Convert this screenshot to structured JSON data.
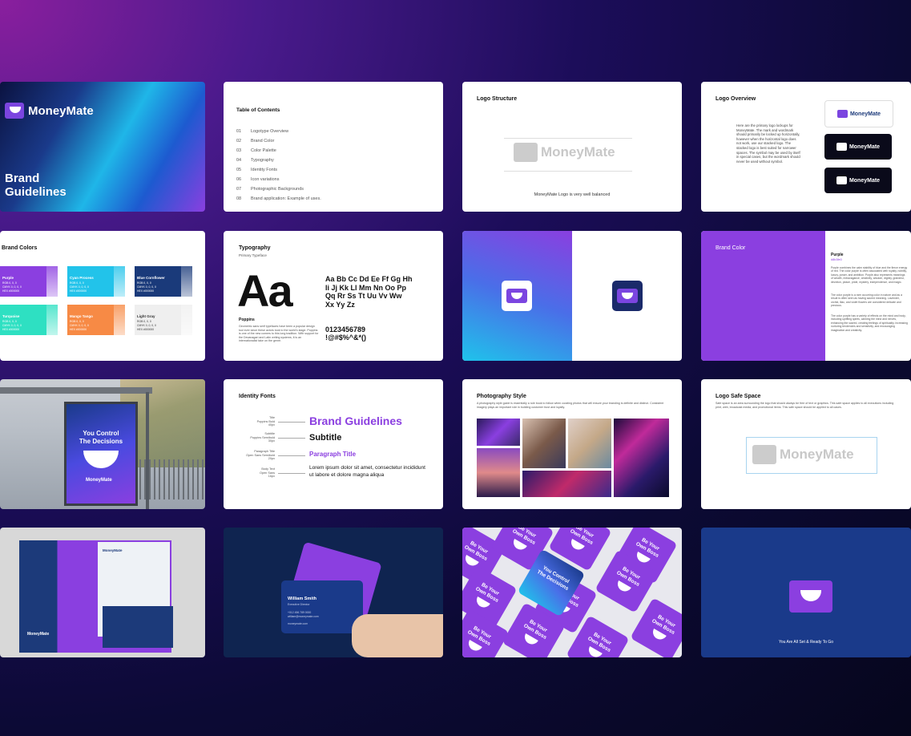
{
  "cover": {
    "brand": "MoneyMate",
    "title_line1": "Brand",
    "title_line2": "Guidelines"
  },
  "toc": {
    "title": "Table of Contents",
    "items": [
      {
        "num": "01",
        "label": "Logotype Overview"
      },
      {
        "num": "02",
        "label": "Brand Color"
      },
      {
        "num": "03",
        "label": "Color Palette"
      },
      {
        "num": "04",
        "label": "Typography"
      },
      {
        "num": "05",
        "label": "Identity Fonts"
      },
      {
        "num": "06",
        "label": "Icon variations"
      },
      {
        "num": "07",
        "label": "Photographic Backgrounds"
      },
      {
        "num": "08",
        "label": "Brand application: Example of uses."
      }
    ]
  },
  "logo_structure": {
    "title": "Logo Structure",
    "brand": "MoneyMate",
    "caption": "MoneyMate Logo is very well balanced"
  },
  "logo_overview": {
    "title": "Logo Overview",
    "body": "Here are the primary logo lockups for MoneyMate. The mark and wordmark should primarily be locked up horizontally, however when the horizontal logo does not work, use our stacked logo. The stacked logo is best suited for narrower spaces. The symbol may be used by itself in special cases, but the wordmark should never be used without symbol.",
    "variants": [
      "MoneyMate",
      "MoneyMate",
      "MoneyMate"
    ]
  },
  "brand_colors": {
    "title": "Brand Colors",
    "swatches": [
      {
        "name": "Purple",
        "rgb": "RGB 0, 0, 0",
        "cmyk": "CMYK 0, 0, 0, 0",
        "hex": "HEX #000000",
        "color": "#8b3fe0"
      },
      {
        "name": "Cyan Process",
        "rgb": "RGB 0, 0, 0",
        "cmyk": "CMYK 0, 0, 0, 0",
        "hex": "HEX #000000",
        "color": "#22c3ea"
      },
      {
        "name": "Blue Cornflower",
        "rgb": "RGB 0, 0, 0",
        "cmyk": "CMYK 0, 0, 0, 0",
        "hex": "HEX #000000",
        "color": "#1a3a7a"
      },
      {
        "name": "Turquoise",
        "rgb": "RGB 0, 0, 0",
        "cmyk": "CMYK 0, 0, 0, 0",
        "hex": "HEX #000000",
        "color": "#2ee0c2"
      },
      {
        "name": "Mango Tango",
        "rgb": "RGB 0, 0, 0",
        "cmyk": "CMYK 0, 0, 0, 0",
        "hex": "HEX #000000",
        "color": "#f78a45"
      },
      {
        "name": "Light Gray",
        "rgb": "RGB 0, 0, 0",
        "cmyk": "CMYK 0, 0, 0, 0",
        "hex": "HEX #000000",
        "color": "#efefef"
      }
    ]
  },
  "typography": {
    "title": "Typography",
    "subtitle": "Primary Typeface",
    "specimen": "Aa",
    "alphabet_line1": "Aa Bb Cc Dd Ee Ff Gg Hh",
    "alphabet_line2": "Ii Jj Kk Ll Mm Nn Oo Pp",
    "alphabet_line3": "Qq Rr Ss Tt Uu Vv Ww",
    "alphabet_line4": "Xx Yy Zz",
    "digits": "0123456789",
    "symbols": "!@#$%^&*()",
    "font_name": "Poppins",
    "font_desc": "Geometric sans serif typefaces have been a popular design tool ever since these actors took to the world's stage. Poppins is one of the new comers to this long tradition. With support for the Devanagari and Latin writing systems, it is an internationalist take on the genre."
  },
  "brand_color": {
    "title": "Brand Color",
    "name": "Purple",
    "hex": "#8b3fe0",
    "p1": "Purple combines the calm stability of blue and the fierce energy of red. The color purple is often associated with royalty, nobility, luxury, power, and ambition. Purple also represents meanings of wealth, extravagance, creativity, wisdom, dignity, grandeur, devotion, peace, pride, mystery, independence, and magic.",
    "p2": "The color purple is a rare occurring color in nature and as a result is often seen as having sacred meaning. Lavender, orchid, lilac, and violet flowers are considered delicate and precious.",
    "p3": "The color purple has a variety of effects on the mind and body, including uplifting spirits, calming the mind and nerves, enhancing the sacred, creating feelings of spirituality, increasing nurturing tendencies and sensitivity, and encouraging imagination and creativity."
  },
  "billboard": {
    "line1": "You Control",
    "line2": "The Decisions",
    "brand": "MoneyMate"
  },
  "identity_fonts": {
    "title": "Identity Fonts",
    "labels": [
      {
        "l1": "Title",
        "l2": "Poppins Bold",
        "l3": "40px"
      },
      {
        "l1": "Subtitle",
        "l2": "Poppins Semibold",
        "l3": "30px"
      },
      {
        "l1": "Paragraph Title",
        "l2": "Open Sans Semibold",
        "l3": "20px"
      },
      {
        "l1": "Body Text",
        "l2": "Open Sans",
        "l3": "16px"
      }
    ],
    "sample_title": "Brand Guidelines",
    "sample_subtitle": "Subtitle",
    "sample_paragraph_title": "Paragraph Title",
    "sample_body": "Lorem ipsum dolor sit amet, consectetur incididunt ut labore et dolore magna aliqua"
  },
  "photography": {
    "title": "Photography Style",
    "body": "A photography style guide is essentially a rule book to follow when curating photos that will ensure your branding is definite and distinct. Consistent imagery plays an important role in building customer trust and loyalty."
  },
  "safe_space": {
    "title": "Logo Safe Space",
    "body": "Safe space is an area surrounding the logo that should always be free of text or graphics. This safe space applies to all executions including print, web, broadcast media, and promotional items. This safe space should be applied to all cases.",
    "brand": "MoneyMate"
  },
  "stationery": {
    "brand": "MoneyMate",
    "letter_brand": "MoneyMate"
  },
  "business_card": {
    "name": "William Smith",
    "role": "Executive Director",
    "phone": "+012 456 789 0000",
    "email": "william@moneymate.com",
    "web": "moneymate.com"
  },
  "stickers": {
    "line1": "Be Your",
    "line2": "Own Boss",
    "peel1": "You Control",
    "peel2": "The Decisions",
    "brand": "MoneyMate"
  },
  "closing": {
    "text": "You Are All Set & Ready To Go"
  }
}
